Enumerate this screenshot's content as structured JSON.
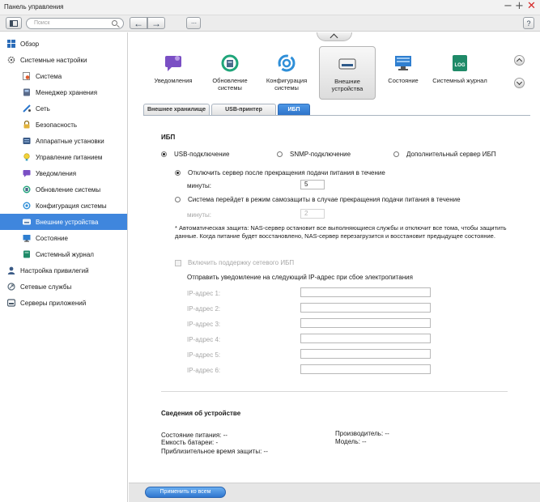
{
  "window": {
    "title": "Панель управления",
    "minimize_glyph": "−",
    "maximize_glyph": "+",
    "close_glyph": "✕"
  },
  "toolbar": {
    "search_placeholder": "Поиск",
    "back_glyph": "←",
    "forward_glyph": "→",
    "grid_glyph": "⋯",
    "help_glyph": "?"
  },
  "sidebar": {
    "items": [
      {
        "label": "Обзор",
        "icon": "overview-icon",
        "level": 0
      },
      {
        "label": "Системные настройки",
        "icon": "gears-icon",
        "level": 0
      },
      {
        "label": "Система",
        "icon": "system-icon",
        "level": 1
      },
      {
        "label": "Менеджер хранения",
        "icon": "storage-icon",
        "level": 1
      },
      {
        "label": "Сеть",
        "icon": "network-icon",
        "level": 1
      },
      {
        "label": "Безопасность",
        "icon": "lock-icon",
        "level": 1
      },
      {
        "label": "Аппаратные установки",
        "icon": "hardware-icon",
        "level": 1
      },
      {
        "label": "Управление питанием",
        "icon": "power-icon",
        "level": 1
      },
      {
        "label": "Уведомления",
        "icon": "notification-icon",
        "level": 1
      },
      {
        "label": "Обновление системы",
        "icon": "update-icon",
        "level": 1
      },
      {
        "label": "Конфигурация системы",
        "icon": "config-icon",
        "level": 1
      },
      {
        "label": "Внешние устройства",
        "icon": "external-device-icon",
        "level": 1,
        "active": true
      },
      {
        "label": "Состояние",
        "icon": "status-icon",
        "level": 1
      },
      {
        "label": "Системный журнал",
        "icon": "log-icon",
        "level": 1
      },
      {
        "label": "Настройка привилегий",
        "icon": "user-icon",
        "level": 0
      },
      {
        "label": "Сетевые службы",
        "icon": "network-services-icon",
        "level": 0
      },
      {
        "label": "Серверы приложений",
        "icon": "app-servers-icon",
        "level": 0
      }
    ]
  },
  "top_icons": [
    {
      "label": "Уведомления",
      "icon": "notification-icon"
    },
    {
      "label": "Обновление системы",
      "icon": "update-icon"
    },
    {
      "label": "Конфигурация системы",
      "icon": "config-icon"
    },
    {
      "label": "Внешние устройства",
      "icon": "external-device-icon",
      "selected": true
    },
    {
      "label": "Состояние",
      "icon": "status-monitor-icon"
    },
    {
      "label": "Системный журнал",
      "icon": "log-icon",
      "badge": "LOG"
    }
  ],
  "subtabs": {
    "tab1": "Внешнее хранилище",
    "tab2": "USB-принтер",
    "tab3": "ИБП",
    "active": "ИБП"
  },
  "ups": {
    "section_title": "ИБП",
    "mode_usb": "USB-подключение",
    "mode_snmp": "SNMP-подключение",
    "mode_net_server": "Дополнительный сервер ИБП",
    "selected_mode": "USB-подключение",
    "option_shutdown": "Отключить сервер после прекращения подачи питания в течение",
    "option_protect": "Система перейдет в режим самозащиты в случае прекращения подачи питания в течение",
    "minutes_label": "минуты:",
    "minutes_shutdown_value": "5",
    "minutes_protect_value": "2",
    "auto_protect_text": "* Автоматическая защита: NAS-сервер остановит все выполняющиеся службы и отключит все тома, чтобы защитить данные. Когда питание будет восстановлено, NAS-сервер перезагрузится и восстановит предыдущее состояние.",
    "enable_network_ups": "Включить поддержку сетевого ИБП",
    "notify_text": "Отправить уведомление на следующий IP-адрес при сбое электропитания",
    "ip_labels": [
      "IP-адрес 1:",
      "IP-адрес 2:",
      "IP-адрес 3:",
      "IP-адрес 4:",
      "IP-адрес 5:",
      "IP-адрес 6:"
    ]
  },
  "device_info": {
    "title": "Сведения об устройстве",
    "power_state_label": "Состояние питания:",
    "power_state_value": "--",
    "battery_label": "Емкость батареи:",
    "battery_value": "-",
    "runtime_label": "Приблизительное время защиты:",
    "runtime_value": "--",
    "manufacturer_label": "Производитель:",
    "manufacturer_value": "--",
    "model_label": "Модель:",
    "model_value": "--"
  },
  "footer": {
    "apply_all": "Применить ко всем"
  },
  "colors": {
    "accent": "#3f86dd",
    "close": "#d42626",
    "notification": "#7a4fc4",
    "update": "#1fa57a",
    "config": "#2f8fd8",
    "status": "#2f7fd0",
    "log": "#1f8a68"
  }
}
